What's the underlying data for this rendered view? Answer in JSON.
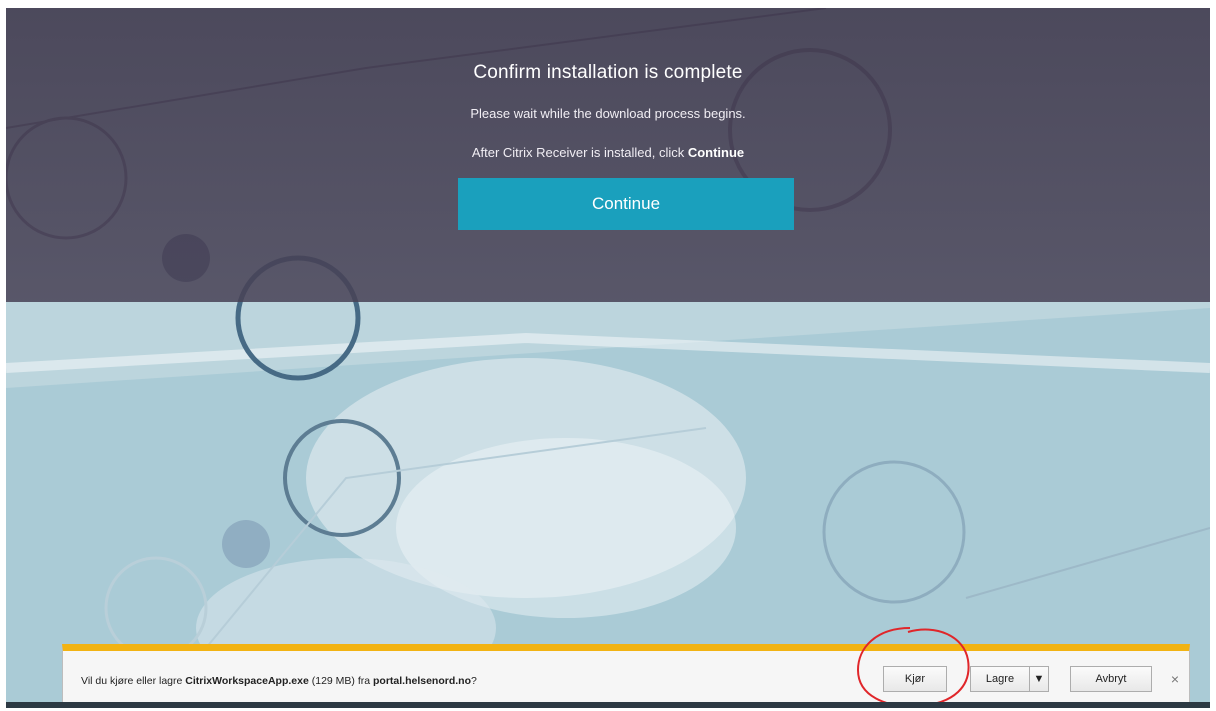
{
  "dialog": {
    "title": "Confirm installation is complete",
    "wait_text": "Please wait while the download process begins.",
    "instruction_prefix": "After Citrix Receiver is installed, click ",
    "instruction_emphasis": "Continue",
    "continue_label": "Continue"
  },
  "download_bar": {
    "message_prefix": "Vil du kjøre eller lagre ",
    "file_name": "CitrixWorkspaceApp.exe",
    "file_size": " (129 MB) fra ",
    "source": "portal.helsenord.no",
    "message_suffix": "?",
    "run_label": "Kjør",
    "save_label": "Lagre",
    "save_menu_glyph": "▼",
    "cancel_label": "Avbryt",
    "close_glyph": "×"
  },
  "colors": {
    "overlay": "#403a4e",
    "continue_button": "#1aa0bd",
    "notification_border": "#f2b313",
    "annotation_circle": "#e0262a"
  },
  "icons": {
    "close": "close-icon",
    "save_menu": "chevron-down-icon"
  }
}
